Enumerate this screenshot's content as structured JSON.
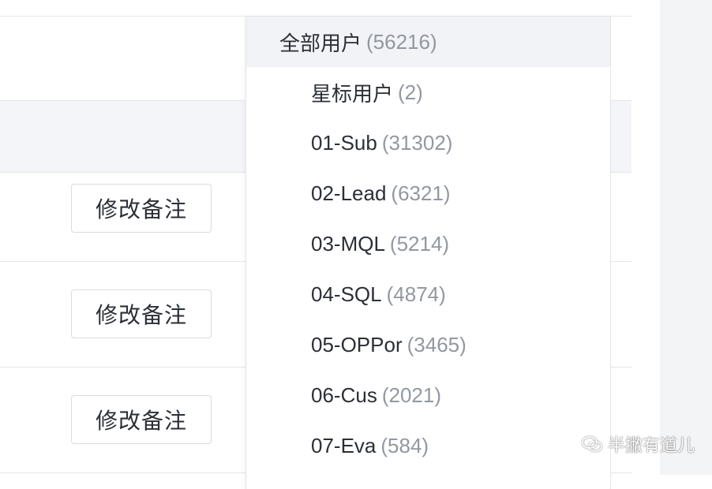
{
  "table": {
    "rows": [
      {
        "action_label": "修改备注"
      },
      {
        "action_label": "修改备注"
      },
      {
        "action_label": "修改备注"
      }
    ]
  },
  "dropdown": {
    "items": [
      {
        "label": "全部用户",
        "count": "(56216)",
        "active": true
      },
      {
        "label": "星标用户",
        "count": "(2)"
      },
      {
        "label": "01-Sub",
        "count": "(31302)"
      },
      {
        "label": "02-Lead",
        "count": "(6321)"
      },
      {
        "label": "03-MQL",
        "count": "(5214)"
      },
      {
        "label": "04-SQL",
        "count": "(4874)"
      },
      {
        "label": "05-OPPor",
        "count": "(3465)"
      },
      {
        "label": "06-Cus",
        "count": "(2021)"
      },
      {
        "label": "07-Eva",
        "count": "(584)"
      }
    ]
  },
  "watermark": {
    "text": "半撇有道儿",
    "icon": "wechat-icon"
  },
  "colors": {
    "text": "#2b2f36",
    "count": "#9298a2",
    "active_bg": "#f2f3f6",
    "header_bg": "#f4f5f8",
    "border": "#e4e6ec"
  }
}
